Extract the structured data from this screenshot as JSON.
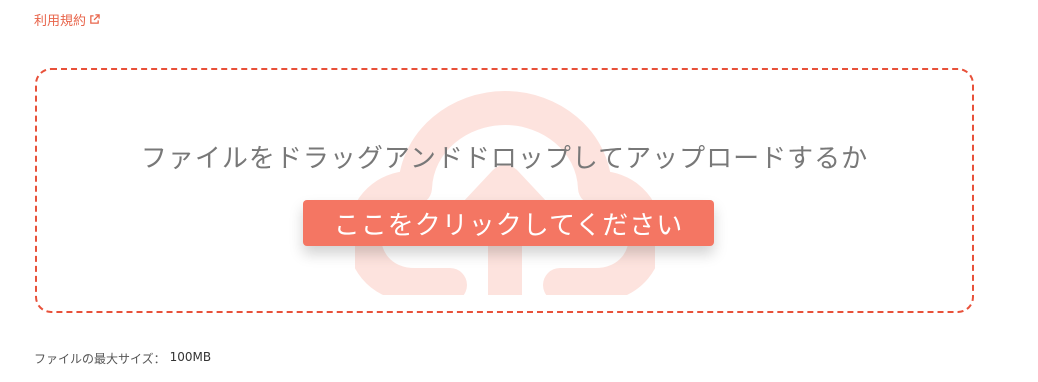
{
  "terms": {
    "label": "利用規約",
    "icon": "external-link-icon",
    "color": "#e8644a"
  },
  "dropzone": {
    "border_color": "#e8513a",
    "background_icon": "cloud-upload-icon",
    "instruction_text": "ファイルをドラッグアンドドロップしてアップロードするか",
    "button_label": "ここをクリックしてください",
    "button_color": "#f47663"
  },
  "limits": {
    "max_size_label": "ファイルの最大サイズ：",
    "max_size_value": "100MB"
  }
}
